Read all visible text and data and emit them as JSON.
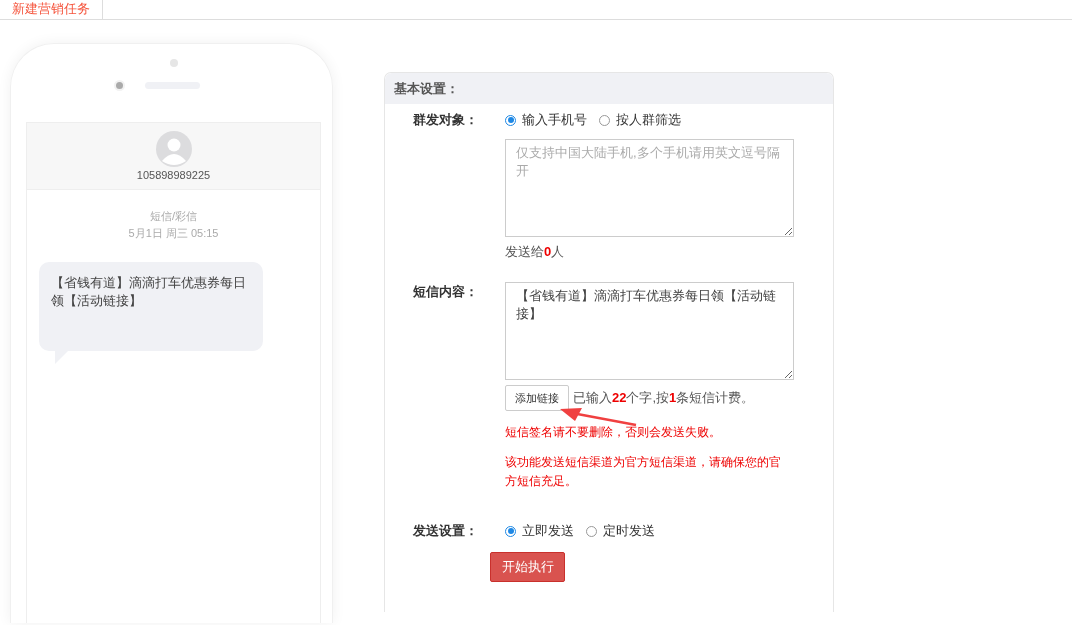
{
  "tabs": [
    {
      "label": "新建营销任务",
      "selected": true
    }
  ],
  "phone_preview": {
    "sender": "105898989225",
    "channel": "短信/彩信",
    "timestamp": "5月1日 周三 05:15",
    "message": "【省钱有道】滴滴打车优惠券每日领【活动链接】"
  },
  "form": {
    "title": "基本设置：",
    "recipients": {
      "label": "群发对象：",
      "options": [
        {
          "label": "输入手机号",
          "selected": true
        },
        {
          "label": "按人群筛选",
          "selected": false
        }
      ],
      "placeholder": "仅支持中国大陆手机,多个手机请用英文逗号隔开",
      "count_note": "发送给**0**人"
    },
    "content": {
      "label": "短信内容：",
      "value": "【省钱有道】滴滴打车优惠券每日领【活动链接】",
      "add_link_button": "添加链接",
      "count_note": "已输入**22**个字,按**1**条短信计费。",
      "warnings": [
        "短信签名请不要删除，否则会发送失败。",
        "该功能发送短信渠道为官方短信渠道，请确保您的官方短信充足。"
      ]
    },
    "send": {
      "label": "发送设置：",
      "options": [
        {
          "label": "立即发送",
          "selected": true
        },
        {
          "label": "定时发送",
          "selected": false
        }
      ]
    },
    "submit_button": "开始执行"
  }
}
